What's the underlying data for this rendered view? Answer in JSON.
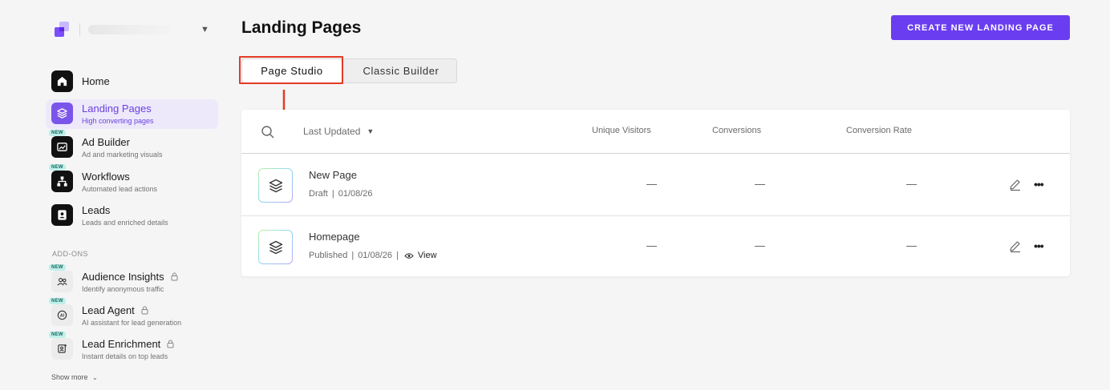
{
  "sidebar": {
    "nav": [
      {
        "title": "Home",
        "sub": ""
      },
      {
        "title": "Landing Pages",
        "sub": "High converting pages"
      },
      {
        "title": "Ad Builder",
        "sub": "Ad and marketing visuals",
        "badge": "NEW"
      },
      {
        "title": "Workflows",
        "sub": "Automated lead actions",
        "badge": "NEW"
      },
      {
        "title": "Leads",
        "sub": "Leads and enriched details"
      }
    ],
    "addons_label": "ADD-ONS",
    "addons": [
      {
        "title": "Audience Insights",
        "sub": "Identify anonymous traffic",
        "badge": "NEW"
      },
      {
        "title": "Lead Agent",
        "sub": "AI assistant for lead generation",
        "badge": "NEW"
      },
      {
        "title": "Lead Enrichment",
        "sub": "Instant details on top leads",
        "badge": "NEW"
      }
    ],
    "show_more": "Show more"
  },
  "header": {
    "title": "Landing Pages",
    "create_button": "CREATE NEW LANDING PAGE"
  },
  "tabs": [
    {
      "label": "Page Studio",
      "active": true
    },
    {
      "label": "Classic Builder",
      "active": false
    }
  ],
  "table": {
    "sort_label": "Last Updated",
    "columns": [
      "Unique Visitors",
      "Conversions",
      "Conversion Rate"
    ],
    "rows": [
      {
        "title": "New Page",
        "status": "Draft",
        "date": "01/08/26",
        "visitors": "—",
        "conversions": "—",
        "rate": "—"
      },
      {
        "title": "Homepage",
        "status": "Published",
        "date": "01/08/26",
        "view_label": "View",
        "visitors": "—",
        "conversions": "—",
        "rate": "—"
      }
    ]
  },
  "colors": {
    "accent": "#6a3df0",
    "highlight": "#e43a26",
    "badge_bg": "#bff0ea"
  }
}
